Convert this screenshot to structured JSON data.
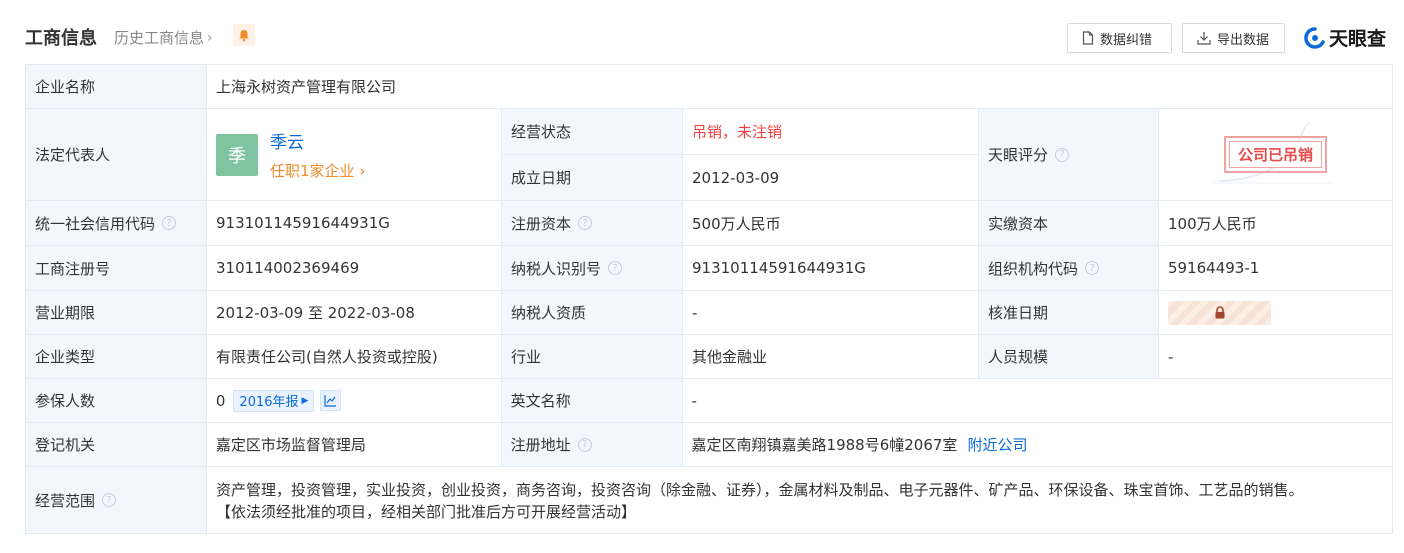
{
  "header": {
    "title": "工商信息",
    "history_link": "历史工商信息",
    "correct_button": "数据纠错",
    "export_button": "导出数据",
    "brand": "天眼查"
  },
  "labels": {
    "company_name": "企业名称",
    "legal_rep": "法定代表人",
    "status": "经营状态",
    "established": "成立日期",
    "tianyan_score": "天眼评分",
    "credit_code": "统一社会信用代码",
    "reg_capital": "注册资本",
    "paid_capital": "实缴资本",
    "reg_number": "工商注册号",
    "taxpayer_id": "纳税人识别号",
    "org_code": "组织机构代码",
    "term": "营业期限",
    "taxpayer_qual": "纳税人资质",
    "approval_date": "核准日期",
    "company_type": "企业类型",
    "industry": "行业",
    "staff_size": "人员规模",
    "insured": "参保人数",
    "english_name": "英文名称",
    "registry": "登记机关",
    "reg_address": "注册地址",
    "scope": "经营范围"
  },
  "values": {
    "company_name": "上海永树资产管理有限公司",
    "legal_rep_avatar": "季",
    "legal_rep_name": "季云",
    "legal_rep_positions": "任职1家企业",
    "status": "吊销，未注销",
    "established": "2012-03-09",
    "score_stamp": "公司已吊销",
    "credit_code": "91310114591644931G",
    "reg_capital": "500万人民币",
    "paid_capital": "100万人民币",
    "reg_number": "310114002369469",
    "taxpayer_id": "91310114591644931G",
    "org_code": "59164493-1",
    "term": "2012-03-09 至 2022-03-08",
    "taxpayer_qual": "-",
    "company_type": "有限责任公司(自然人投资或控股)",
    "industry": "其他金融业",
    "staff_size": "-",
    "insured": "0",
    "insured_report": "2016年报",
    "english_name": "-",
    "registry": "嘉定区市场监督管理局",
    "reg_address": "嘉定区南翔镇嘉美路1988号6幢2067室",
    "nearby_link": "附近公司",
    "scope_line1": "资产管理，投资管理，实业投资，创业投资，商务咨询，投资咨询（除金融、证券），金属材料及制品、电子元器件、矿产品、环保设备、珠宝首饰、工艺品的销售。",
    "scope_line2": "【依法须经批准的项目，经相关部门批准后方可开展经营活动】"
  },
  "icons": [
    "bell-icon",
    "document-icon",
    "download-icon",
    "brand-logo-icon",
    "help-icon",
    "lock-icon",
    "chart-icon"
  ],
  "colors": {
    "label_bg": "#f3f7fd",
    "border": "#e4eaf2",
    "link_blue": "#0a6ad8",
    "status_red": "#f04142",
    "orange": "#f08c2b"
  }
}
